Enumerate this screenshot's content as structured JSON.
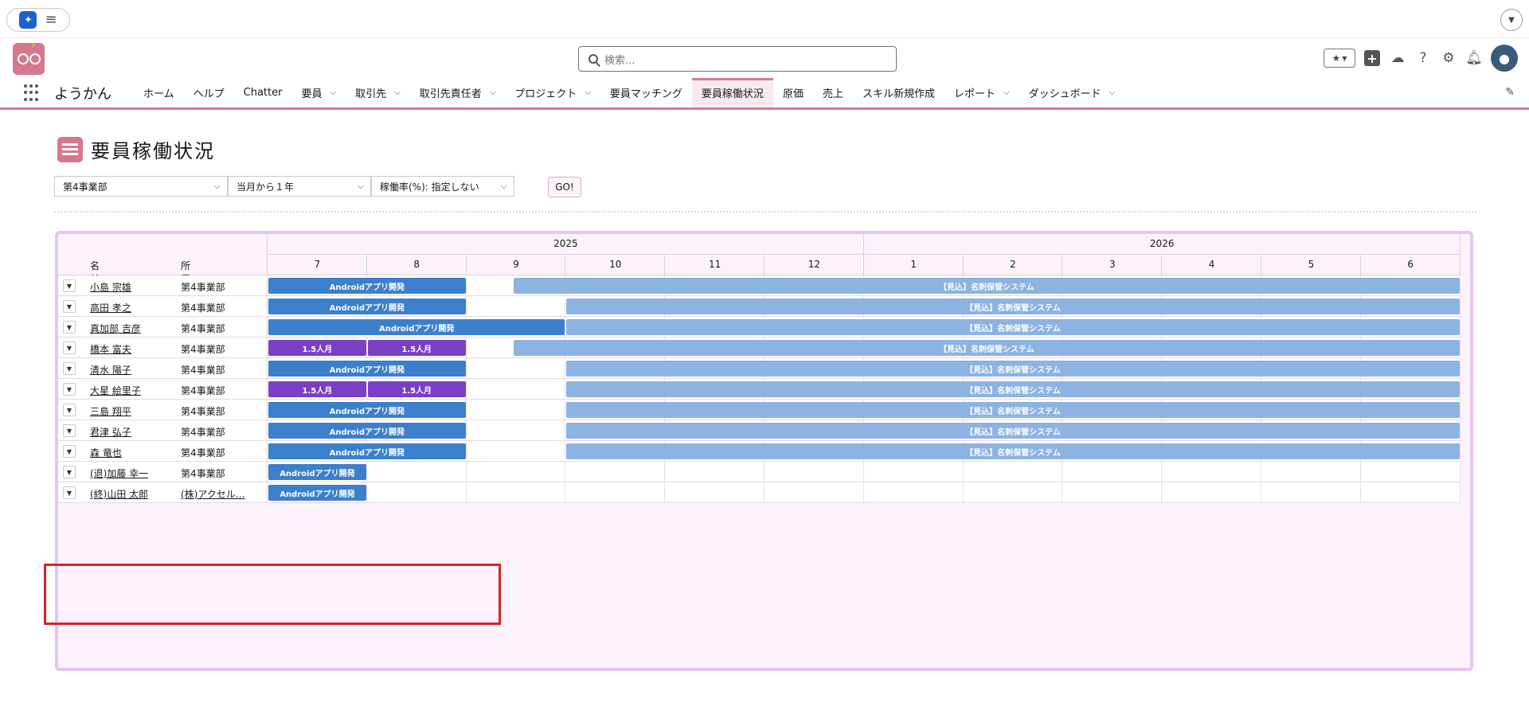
{
  "header": {
    "search_placeholder": "検索...",
    "app_name": "ようかん"
  },
  "nav": {
    "items": [
      {
        "label": "ホーム",
        "dropdown": false,
        "active": false
      },
      {
        "label": "ヘルプ",
        "dropdown": false,
        "active": false
      },
      {
        "label": "Chatter",
        "dropdown": false,
        "active": false
      },
      {
        "label": "要員",
        "dropdown": true,
        "active": false
      },
      {
        "label": "取引先",
        "dropdown": true,
        "active": false
      },
      {
        "label": "取引先責任者",
        "dropdown": true,
        "active": false
      },
      {
        "label": "プロジェクト",
        "dropdown": true,
        "active": false
      },
      {
        "label": "要員マッチング",
        "dropdown": false,
        "active": false
      },
      {
        "label": "要員稼働状況",
        "dropdown": false,
        "active": true
      },
      {
        "label": "原価",
        "dropdown": false,
        "active": false
      },
      {
        "label": "売上",
        "dropdown": false,
        "active": false
      },
      {
        "label": "スキル新規作成",
        "dropdown": false,
        "active": false
      },
      {
        "label": "レポート",
        "dropdown": true,
        "active": false
      },
      {
        "label": "ダッシュボード",
        "dropdown": true,
        "active": false
      }
    ]
  },
  "page": {
    "title": "要員稼働状況",
    "filters": {
      "department": "第4事業部",
      "period": "当月から１年",
      "utilization": "稼働率(%): 指定しない"
    },
    "go_label": "GO!"
  },
  "gantt": {
    "years": [
      {
        "label": "2025",
        "span": 6
      },
      {
        "label": "2026",
        "span": 6
      }
    ],
    "col_name": "名前",
    "col_dept": "所属",
    "months": [
      "7",
      "8",
      "9",
      "10",
      "11",
      "12",
      "1",
      "2",
      "3",
      "4",
      "5",
      "6"
    ],
    "rows": [
      {
        "name": "小島 宗雄",
        "dept": "第4事業部",
        "dept_link": false,
        "bars": [
          {
            "label": "Androidアプリ開発",
            "kind": "blue",
            "start": 0,
            "end": 2
          },
          {
            "label": "【見込】名刺保管システム",
            "kind": "light",
            "start": 2.47,
            "end": 12
          }
        ]
      },
      {
        "name": "高田 孝之",
        "dept": "第4事業部",
        "dept_link": false,
        "bars": [
          {
            "label": "Androidアプリ開発",
            "kind": "blue",
            "start": 0,
            "end": 2
          },
          {
            "label": "【見込】名刺保管システム",
            "kind": "light",
            "start": 3,
            "end": 12
          }
        ]
      },
      {
        "name": "真加部 吉彦",
        "dept": "第4事業部",
        "dept_link": false,
        "bars": [
          {
            "label": "Androidアプリ開発",
            "kind": "blue",
            "start": 0,
            "end": 3
          },
          {
            "label": "【見込】名刺保管システム",
            "kind": "light",
            "start": 3,
            "end": 12
          }
        ]
      },
      {
        "name": "橋本 富夫",
        "dept": "第4事業部",
        "dept_link": false,
        "bars": [
          {
            "label": "1.5人月",
            "kind": "purple",
            "start": 0,
            "end": 1
          },
          {
            "label": "1.5人月",
            "kind": "purple",
            "start": 1,
            "end": 2
          },
          {
            "label": "【見込】名刺保管システム",
            "kind": "light",
            "start": 2.47,
            "end": 12
          }
        ]
      },
      {
        "name": "清水 陽子",
        "dept": "第4事業部",
        "dept_link": false,
        "bars": [
          {
            "label": "Androidアプリ開発",
            "kind": "blue",
            "start": 0,
            "end": 2
          },
          {
            "label": "【見込】名刺保管システム",
            "kind": "light",
            "start": 3,
            "end": 12
          }
        ]
      },
      {
        "name": "大星 絵里子",
        "dept": "第4事業部",
        "dept_link": false,
        "bars": [
          {
            "label": "1.5人月",
            "kind": "purple",
            "start": 0,
            "end": 1
          },
          {
            "label": "1.5人月",
            "kind": "purple",
            "start": 1,
            "end": 2
          },
          {
            "label": "【見込】名刺保管システム",
            "kind": "light",
            "start": 3,
            "end": 12
          }
        ]
      },
      {
        "name": "三島 翔平",
        "dept": "第4事業部",
        "dept_link": false,
        "bars": [
          {
            "label": "Androidアプリ開発",
            "kind": "blue",
            "start": 0,
            "end": 2
          },
          {
            "label": "【見込】名刺保管システム",
            "kind": "light",
            "start": 3,
            "end": 12
          }
        ]
      },
      {
        "name": "君津 弘子",
        "dept": "第4事業部",
        "dept_link": false,
        "bars": [
          {
            "label": "Androidアプリ開発",
            "kind": "blue",
            "start": 0,
            "end": 2
          },
          {
            "label": "【見込】名刺保管システム",
            "kind": "light",
            "start": 3,
            "end": 12
          }
        ]
      },
      {
        "name": "森 竜也",
        "dept": "第4事業部",
        "dept_link": false,
        "bars": [
          {
            "label": "Androidアプリ開発",
            "kind": "blue",
            "start": 0,
            "end": 2
          },
          {
            "label": "【見込】名刺保管システム",
            "kind": "light",
            "start": 3,
            "end": 12
          }
        ]
      },
      {
        "name": "(退)加藤 幸一",
        "dept": "第4事業部",
        "dept_link": false,
        "bars": [
          {
            "label": "Androidアプリ開発",
            "kind": "blue",
            "start": 0,
            "end": 1
          }
        ]
      },
      {
        "name": "(終)山田 太郎",
        "dept": "(株)アクセル…",
        "dept_link": true,
        "bars": [
          {
            "label": "Androidアプリ開発",
            "kind": "blue",
            "start": 0,
            "end": 1
          }
        ]
      }
    ]
  },
  "colors": {
    "brand": "#d4788e",
    "bar_blue": "#3c7fcc",
    "bar_light": "#8cb3e2",
    "bar_purple": "#7b3fc4",
    "highlight": "#d8222b"
  }
}
